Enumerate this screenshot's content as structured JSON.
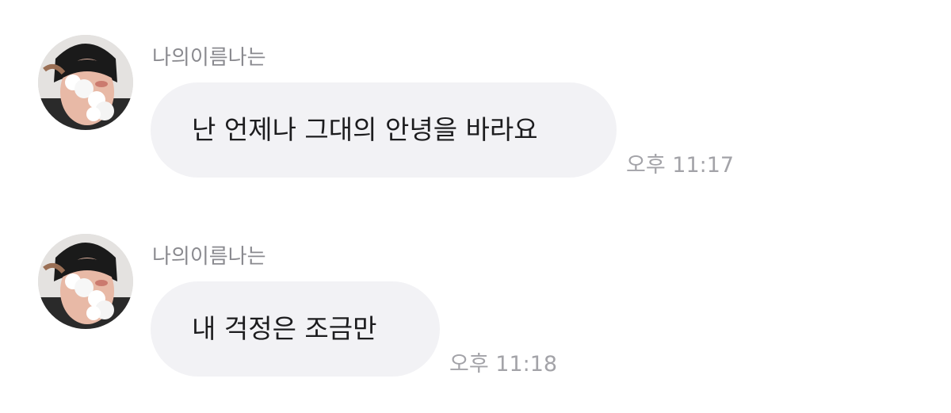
{
  "messages": [
    {
      "sender": "나의이름나는",
      "text": "난 언제나 그대의 안녕을 바라요",
      "time": "오후 11:17",
      "avatar_icon": "profile-photo"
    },
    {
      "sender": "나의이름나는",
      "text": "내 걱정은 조금만",
      "time": "오후 11:18",
      "avatar_icon": "profile-photo"
    }
  ],
  "colors": {
    "background": "#ffffff",
    "bubble": "#f2f2f5",
    "sender_name": "#8a8a8f",
    "message_text": "#1c1c1e",
    "timestamp": "#a3a3a8"
  }
}
